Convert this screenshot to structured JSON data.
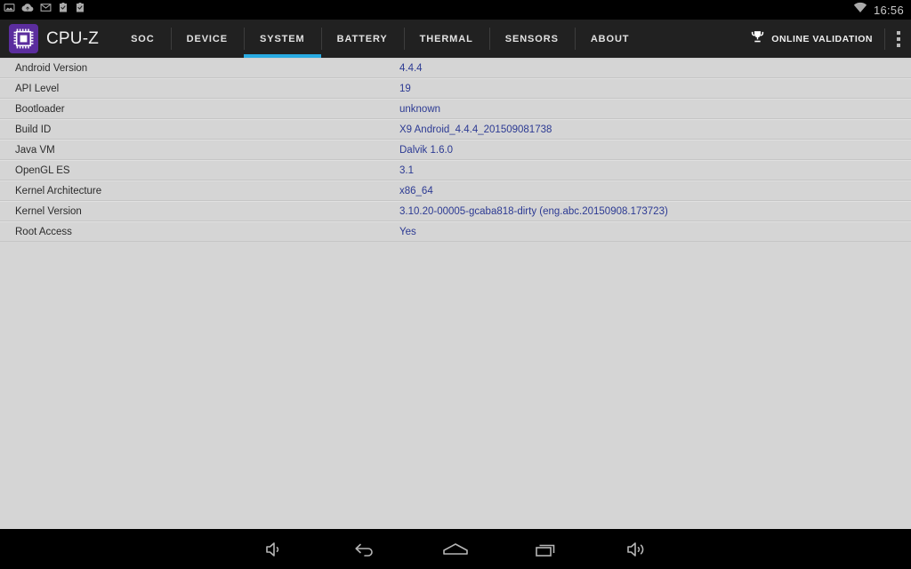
{
  "statusbar": {
    "icons": [
      "screenshot-icon",
      "cloud-upload-icon",
      "gmail-icon",
      "clipboard-check-icon",
      "clipboard-check-icon-2"
    ],
    "wifi_icon": "wifi-icon",
    "time": "16:56"
  },
  "appbar": {
    "logo_icon": "cpu-chip-icon",
    "logo_color": "#5b2d9e",
    "brand": "CPU-Z",
    "accent_color": "#29abe2",
    "tabs": [
      {
        "label": "SOC",
        "active": false
      },
      {
        "label": "DEVICE",
        "active": false
      },
      {
        "label": "SYSTEM",
        "active": true
      },
      {
        "label": "BATTERY",
        "active": false
      },
      {
        "label": "THERMAL",
        "active": false
      },
      {
        "label": "SENSORS",
        "active": false
      },
      {
        "label": "ABOUT",
        "active": false
      }
    ],
    "validation": {
      "icon": "trophy-icon",
      "label": "ONLINE VALIDATION"
    },
    "overflow_icon": "overflow-menu-icon"
  },
  "system": {
    "rows": [
      {
        "label": "Android Version",
        "value": "4.4.4"
      },
      {
        "label": "API Level",
        "value": "19"
      },
      {
        "label": "Bootloader",
        "value": "unknown"
      },
      {
        "label": "Build ID",
        "value": "X9 Android_4.4.4_201509081738"
      },
      {
        "label": "Java VM",
        "value": "Dalvik 1.6.0"
      },
      {
        "label": "OpenGL ES",
        "value": "3.1"
      },
      {
        "label": "Kernel Architecture",
        "value": "x86_64"
      },
      {
        "label": "Kernel Version",
        "value": "3.10.20-00005-gcaba818-dirty (eng.abc.20150908.173723)"
      },
      {
        "label": "Root Access",
        "value": "Yes"
      }
    ],
    "value_color": "#2c3a93"
  },
  "navbar": {
    "buttons": [
      {
        "name": "volume-down-icon"
      },
      {
        "name": "back-icon"
      },
      {
        "name": "home-icon"
      },
      {
        "name": "recents-icon"
      },
      {
        "name": "volume-up-icon"
      }
    ]
  }
}
